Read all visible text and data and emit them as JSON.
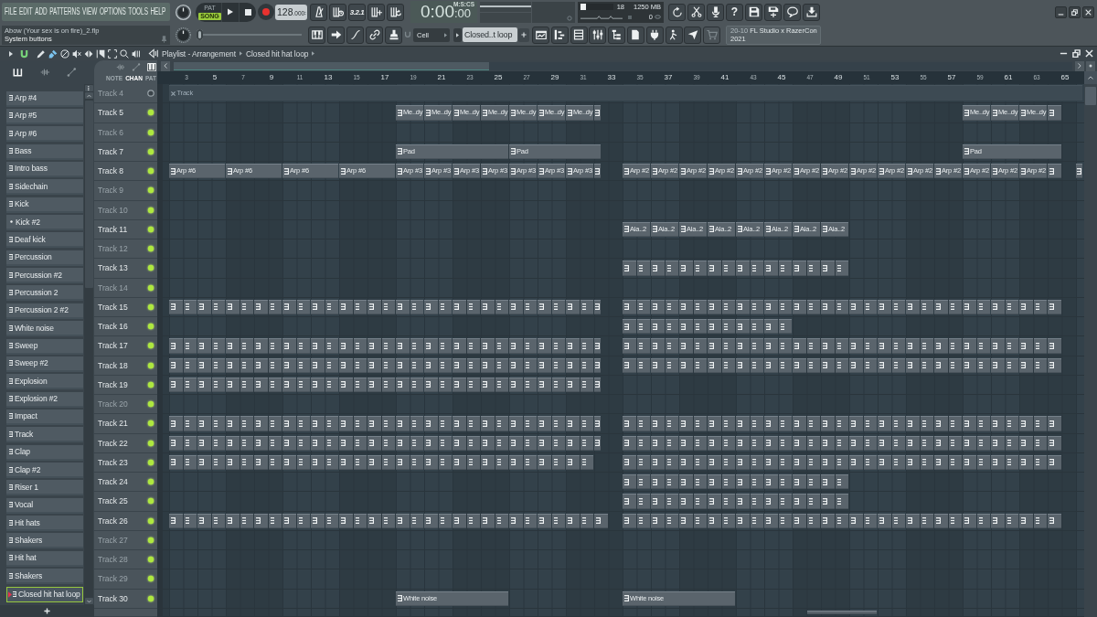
{
  "menu": [
    "FILE",
    "EDIT",
    "ADD",
    "PATTERNS",
    "VIEW",
    "OPTIONS",
    "TOOLS",
    "HELP"
  ],
  "hint": {
    "file": "Abow (Your sex is on fire)_2.flp",
    "message": "System buttons"
  },
  "transport": {
    "modes": [
      {
        "label": "PAT",
        "selected": false
      },
      {
        "label": "SONG",
        "selected": true
      }
    ],
    "tempo": "128",
    "tempo_decimals": ".000"
  },
  "countdown": "3.2.1",
  "clock": {
    "time": "0:00",
    "centiseconds": ":00",
    "unit": "M:S:CS"
  },
  "monitor": {
    "cpu": {
      "level": 0.18,
      "reading": "18"
    },
    "memory": "1250 MB",
    "polyphony": "0"
  },
  "help": "?",
  "master_slider": {
    "level": 0
  },
  "snap": "Cell",
  "pattern_selector": "Closed..t loop",
  "news": {
    "date": "20-10",
    "title": "FL Studio x RazerCon",
    "title_end": "2021"
  },
  "pattern_panel": {
    "filters": [
      {
        "kind": "pattern",
        "selected": true
      },
      {
        "kind": "audio",
        "selected": false
      },
      {
        "kind": "automation",
        "selected": false
      }
    ],
    "patterns": [
      {
        "name": "Arp #4",
        "kind": "pattern",
        "selected": false
      },
      {
        "name": "Arp #5",
        "kind": "pattern",
        "selected": false
      },
      {
        "name": "Arp #6",
        "kind": "pattern",
        "selected": false
      },
      {
        "name": "Bass",
        "kind": "pattern",
        "selected": false
      },
      {
        "name": "Intro bass",
        "kind": "pattern",
        "selected": false
      },
      {
        "name": "Sidechain",
        "kind": "pattern",
        "selected": false
      },
      {
        "name": "Kick",
        "kind": "pattern",
        "selected": false
      },
      {
        "name": "Kick #2",
        "kind": "audio",
        "selected": false
      },
      {
        "name": "Deaf kick",
        "kind": "pattern",
        "selected": false
      },
      {
        "name": "Percussion",
        "kind": "pattern",
        "selected": false
      },
      {
        "name": "Percussion #2",
        "kind": "pattern",
        "selected": false
      },
      {
        "name": "Percussion 2",
        "kind": "pattern",
        "selected": false
      },
      {
        "name": "Percussion 2 #2",
        "kind": "pattern",
        "selected": false
      },
      {
        "name": "White noise",
        "kind": "pattern",
        "selected": false
      },
      {
        "name": "Sweep",
        "kind": "pattern",
        "selected": false
      },
      {
        "name": "Sweep #2",
        "kind": "pattern",
        "selected": false
      },
      {
        "name": "Explosion",
        "kind": "pattern",
        "selected": false
      },
      {
        "name": "Explosion #2",
        "kind": "pattern",
        "selected": false
      },
      {
        "name": "Impact",
        "kind": "pattern",
        "selected": false
      },
      {
        "name": "Track",
        "kind": "pattern",
        "selected": false
      },
      {
        "name": "Clap",
        "kind": "pattern",
        "selected": false
      },
      {
        "name": "Clap #2",
        "kind": "pattern",
        "selected": false
      },
      {
        "name": "Riser 1",
        "kind": "pattern",
        "selected": false
      },
      {
        "name": "Vocal",
        "kind": "pattern",
        "selected": false
      },
      {
        "name": "Hit hats",
        "kind": "pattern",
        "selected": false
      },
      {
        "name": "Shakers",
        "kind": "pattern",
        "selected": false
      },
      {
        "name": "Hit hat",
        "kind": "pattern",
        "selected": false
      },
      {
        "name": "Shakers",
        "kind": "pattern",
        "selected": false
      },
      {
        "name": "Closed hit hat loop",
        "kind": "pattern",
        "selected": true
      }
    ]
  },
  "playlist": {
    "title": "Playlist - Arrangement",
    "pattern": "Closed hit hat loop",
    "tools": [
      {
        "kind": "draw",
        "selected": false
      },
      {
        "kind": "paint",
        "selected": true
      },
      {
        "kind": "delete",
        "selected": false
      },
      {
        "kind": "mute",
        "selected": false
      },
      {
        "kind": "slip",
        "selected": false
      },
      {
        "kind": "slice",
        "selected": false
      },
      {
        "kind": "select",
        "selected": false
      },
      {
        "kind": "zoom",
        "selected": false
      },
      {
        "kind": "playback",
        "selected": false
      }
    ],
    "clip_filters": [
      {
        "kind": "audio",
        "selected": false
      },
      {
        "kind": "automation",
        "selected": false
      },
      {
        "kind": "pattern",
        "selected": true
      }
    ],
    "layers": [
      {
        "label": "NOTE",
        "selected": false
      },
      {
        "label": "CHAN",
        "selected": true
      },
      {
        "label": "PAT",
        "selected": false
      }
    ],
    "ruler": [
      "3",
      "5",
      "7",
      "9",
      "11",
      "13",
      "15",
      "17",
      "19",
      "21",
      "23",
      "25",
      "27",
      "29",
      "31",
      "33",
      "35",
      "37",
      "39",
      "41",
      "43",
      "45",
      "47",
      "49",
      "51",
      "53",
      "55",
      "57",
      "59",
      "61",
      "63",
      "65"
    ],
    "tracks": [
      {
        "name": "Track 4",
        "muted": true,
        "clips": [
          {
            "kind": "audio",
            "label": "Track"
          }
        ]
      },
      {
        "name": "Track 5",
        "muted": false,
        "clips": [
          {
            "kind": "pattern",
            "label": "Me..dy"
          },
          {
            "kind": "pattern",
            "label": "Me..dy"
          },
          {
            "kind": "pattern",
            "label": "Me..dy"
          },
          {
            "kind": "pattern",
            "label": "Me..dy"
          },
          {
            "kind": "pattern",
            "label": "Me..dy"
          },
          {
            "kind": "pattern",
            "label": "Me..dy"
          },
          {
            "kind": "pattern",
            "label": "Me..dy"
          },
          {
            "kind": "pattern"
          },
          {
            "kind": "pattern",
            "label": "Me..dy"
          },
          {
            "kind": "pattern",
            "label": "Me..dy"
          },
          {
            "kind": "pattern",
            "label": "Me..dy"
          },
          {
            "kind": "pattern"
          }
        ]
      },
      {
        "name": "Track 6",
        "muted": false
      },
      {
        "name": "Track 7",
        "muted": false,
        "clips": [
          {
            "kind": "pattern",
            "label": "Pad"
          },
          {
            "kind": "pattern",
            "label": "Pad"
          },
          {
            "kind": "pattern",
            "label": "Pad"
          }
        ]
      },
      {
        "name": "Track 8",
        "muted": false,
        "clips": [
          {
            "kind": "pattern",
            "label": "Arp #6"
          },
          {
            "kind": "pattern",
            "label": "Arp #6"
          },
          {
            "kind": "pattern",
            "label": "Arp #6"
          },
          {
            "kind": "pattern",
            "label": "Arp #6"
          },
          {
            "kind": "pattern",
            "label": "Arp #3"
          },
          {
            "kind": "pattern",
            "label": "Arp #3"
          },
          {
            "kind": "pattern",
            "label": "Arp #3"
          },
          {
            "kind": "pattern",
            "label": "Arp #3"
          },
          {
            "kind": "pattern",
            "label": "Arp #3"
          },
          {
            "kind": "pattern",
            "label": "Arp #3"
          },
          {
            "kind": "pattern",
            "label": "Arp #3"
          },
          {
            "kind": "pattern"
          },
          {
            "kind": "pattern",
            "label": "Arp #2"
          },
          {
            "kind": "pattern",
            "label": "Arp #2"
          },
          {
            "kind": "pattern",
            "label": "Arp #2"
          },
          {
            "kind": "pattern",
            "label": "Arp #2"
          },
          {
            "kind": "pattern",
            "label": "Arp #2"
          },
          {
            "kind": "pattern",
            "label": "Arp #2"
          },
          {
            "kind": "pattern",
            "label": "Arp #2"
          },
          {
            "kind": "pattern",
            "label": "Arp #2"
          },
          {
            "kind": "pattern",
            "label": "Arp #2"
          },
          {
            "kind": "pattern",
            "label": "Arp #2"
          },
          {
            "kind": "pattern",
            "label": "Arp #2"
          },
          {
            "kind": "pattern",
            "label": "Arp #2"
          },
          {
            "kind": "pattern",
            "label": "Arp #2"
          },
          {
            "kind": "pattern",
            "label": "Arp #2"
          },
          {
            "kind": "pattern",
            "label": "Arp #2"
          },
          {
            "kind": "pattern"
          },
          {
            "kind": "pattern"
          }
        ]
      },
      {
        "name": "Track 9",
        "muted": false
      },
      {
        "name": "Track 10",
        "muted": false
      },
      {
        "name": "Track 11",
        "muted": false,
        "clips": [
          {
            "kind": "pattern",
            "label": "Ala..2"
          },
          {
            "kind": "pattern",
            "label": "Ala..2"
          },
          {
            "kind": "pattern",
            "label": "Ala..2"
          },
          {
            "kind": "pattern",
            "label": "Ala..2"
          },
          {
            "kind": "pattern",
            "label": "Ala..2"
          },
          {
            "kind": "pattern",
            "label": "Ala..2"
          },
          {
            "kind": "pattern",
            "label": "Ala..2"
          },
          {
            "kind": "pattern",
            "label": "Ala..2"
          }
        ]
      },
      {
        "name": "Track 12",
        "muted": false
      },
      {
        "name": "Track 13",
        "muted": false,
        "clips": [
          {
            "kind": "run"
          }
        ]
      },
      {
        "name": "Track 14",
        "muted": false
      },
      {
        "name": "Track 15",
        "muted": false,
        "clips": [
          {
            "kind": "run"
          },
          {
            "kind": "run"
          }
        ]
      },
      {
        "name": "Track 16",
        "muted": false,
        "clips": [
          {
            "kind": "run"
          }
        ]
      },
      {
        "name": "Track 17",
        "muted": false,
        "clips": [
          {
            "kind": "run"
          },
          {
            "kind": "run"
          }
        ]
      },
      {
        "name": "Track 18",
        "muted": false,
        "clips": [
          {
            "kind": "run"
          },
          {
            "kind": "run"
          }
        ]
      },
      {
        "name": "Track 19",
        "muted": false,
        "clips": [
          {
            "kind": "run"
          }
        ]
      },
      {
        "name": "Track 20",
        "muted": false
      },
      {
        "name": "Track 21",
        "muted": false,
        "clips": [
          {
            "kind": "run"
          },
          {
            "kind": "run"
          }
        ]
      },
      {
        "name": "Track 22",
        "muted": false,
        "clips": [
          {
            "kind": "run"
          },
          {
            "kind": "run"
          }
        ]
      },
      {
        "name": "Track 23",
        "muted": false,
        "clips": [
          {
            "kind": "run"
          },
          {
            "kind": "run"
          }
        ]
      },
      {
        "name": "Track 24",
        "muted": false,
        "clips": [
          {
            "kind": "run"
          }
        ]
      },
      {
        "name": "Track 25",
        "muted": false,
        "clips": [
          {
            "kind": "run"
          }
        ]
      },
      {
        "name": "Track 26",
        "muted": false,
        "clips": [
          {
            "kind": "run"
          },
          {
            "kind": "run"
          }
        ]
      },
      {
        "name": "Track 27",
        "muted": false
      },
      {
        "name": "Track 28",
        "muted": false
      },
      {
        "name": "Track 29",
        "muted": false
      },
      {
        "name": "Track 30",
        "muted": false,
        "clips": [
          {
            "kind": "pattern",
            "label": "White noise"
          },
          {
            "kind": "pattern",
            "label": "White noise"
          }
        ]
      },
      {
        "clips": [
          {
            "kind": "blank"
          }
        ]
      }
    ]
  }
}
